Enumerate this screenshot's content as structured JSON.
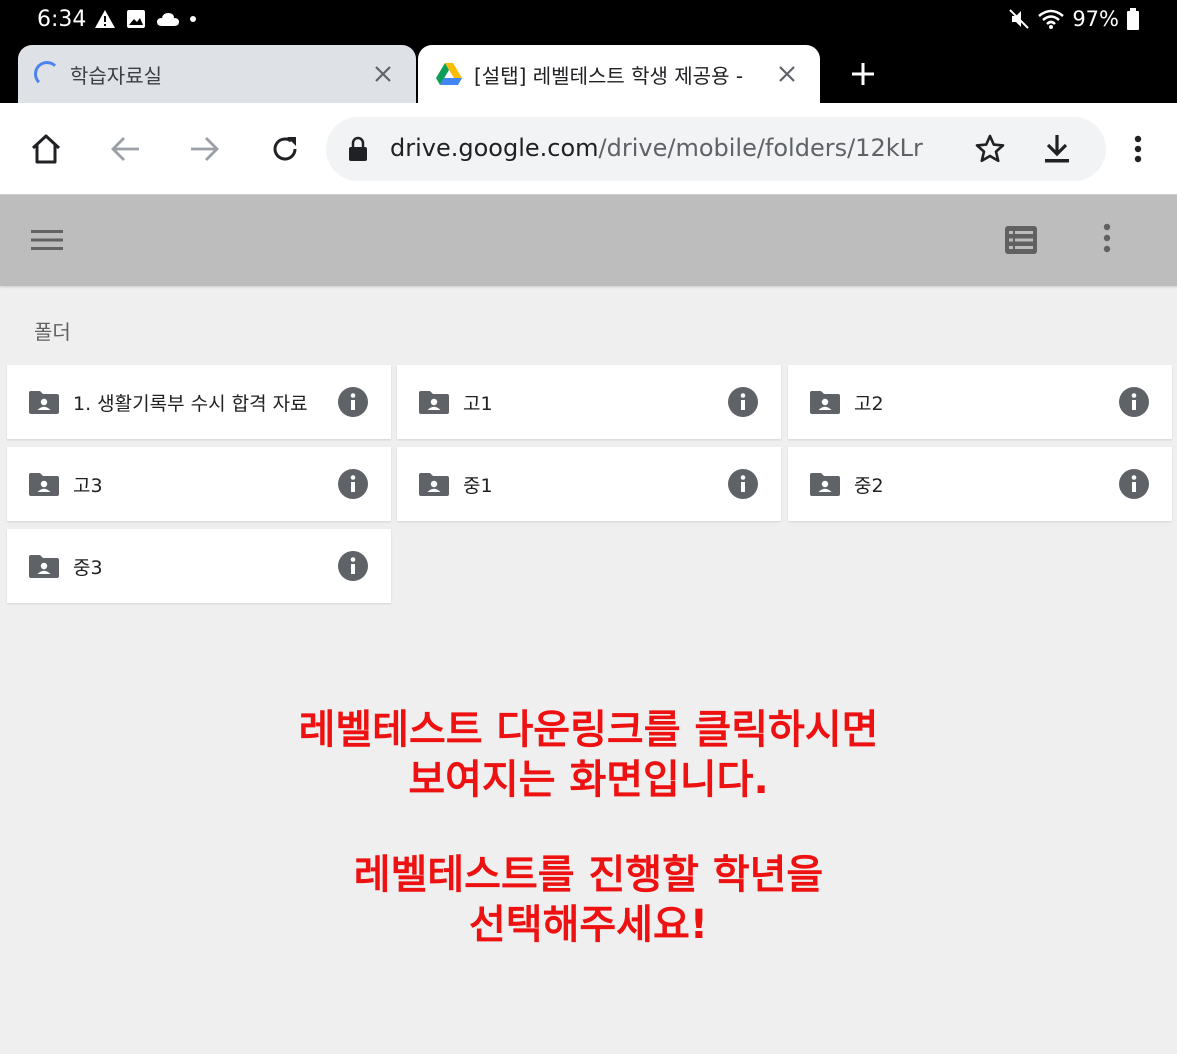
{
  "status_bar": {
    "time": "6:34",
    "battery": "97%"
  },
  "tabs": [
    {
      "title": "학습자료실",
      "active": false,
      "loading": true
    },
    {
      "title": "[설탭] 레벨테스트 학생 제공용 -",
      "active": true,
      "loading": false
    }
  ],
  "toolbar": {
    "url_domain": "drive.google.com",
    "url_path": "/drive/mobile/folders/12kLr"
  },
  "drive": {
    "section_label": "폴더",
    "folders": [
      {
        "name": "1. 생활기록부 수시 합격 자료"
      },
      {
        "name": "고1"
      },
      {
        "name": "고2"
      },
      {
        "name": "고3"
      },
      {
        "name": "중1"
      },
      {
        "name": "중2"
      },
      {
        "name": "중3"
      }
    ]
  },
  "annotation": {
    "line1": "레벨테스트 다운링크를 클릭하시면",
    "line2": "보여지는 화면입니다.",
    "line3": "레벨테스트를 진행할 학년을",
    "line4": "선택해주세요!",
    "color": "#ee1111"
  },
  "colors": {
    "drive_header": "#bdbdbd",
    "background": "#efefef",
    "icon_gray": "#5f6368"
  }
}
